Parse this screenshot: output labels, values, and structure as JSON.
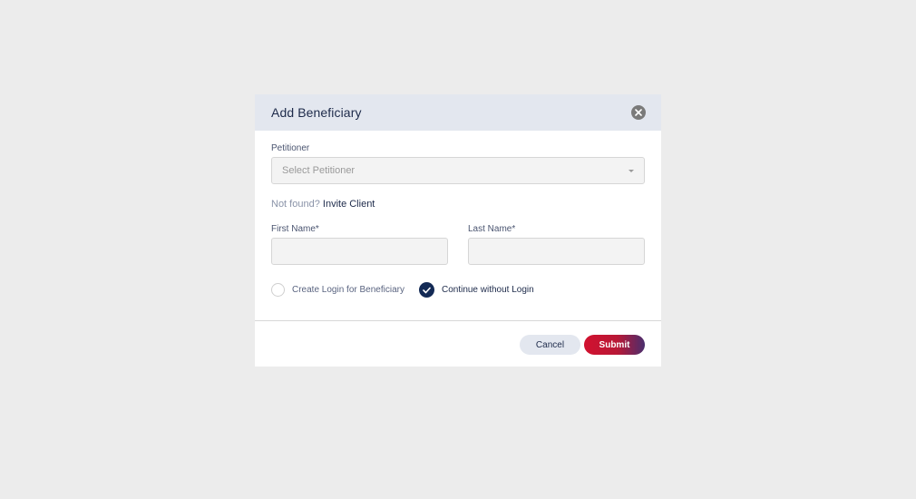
{
  "modal": {
    "title": "Add Beneficiary",
    "close_icon": "close-icon"
  },
  "petitioner": {
    "label": "Petitioner",
    "placeholder": "Select Petitioner"
  },
  "not_found": {
    "text": "Not found?",
    "link": "Invite Client"
  },
  "first_name": {
    "label": "First Name*",
    "value": ""
  },
  "last_name": {
    "label": "Last Name*",
    "value": ""
  },
  "login_options": {
    "option1": {
      "label": "Create Login for Beneficiary",
      "selected": false
    },
    "option2": {
      "label": "Continue without Login",
      "selected": true
    }
  },
  "footer": {
    "cancel_label": "Cancel",
    "submit_label": "Submit"
  },
  "colors": {
    "page_bg": "#ececec",
    "header_bg": "#e3e7ef",
    "primary_navy": "#132a55",
    "submit_red": "#d2112f",
    "submit_purple": "#4a2e6e"
  }
}
